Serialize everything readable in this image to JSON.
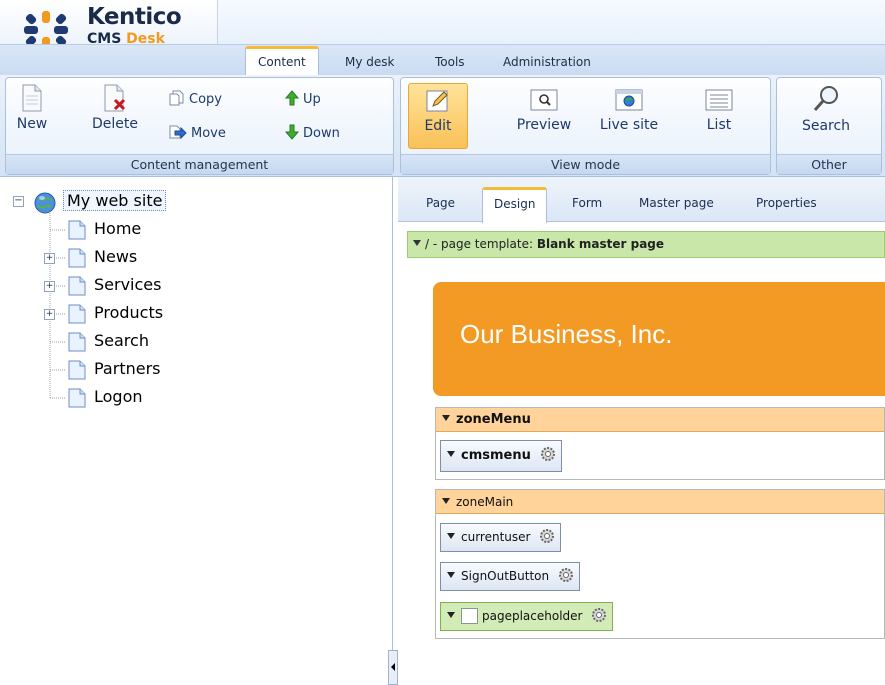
{
  "app": {
    "logo_brand": "Kentico",
    "logo_product_1": "CMS",
    "logo_product_2": "Desk",
    "accent_color": "#f39a1e"
  },
  "main_tabs": [
    {
      "label": "Content",
      "active": true
    },
    {
      "label": "My desk",
      "active": false
    },
    {
      "label": "Tools",
      "active": false
    },
    {
      "label": "Administration",
      "active": false
    }
  ],
  "toolbar": {
    "content_management": {
      "title": "Content management",
      "new_label": "New",
      "delete_label": "Delete",
      "copy_label": "Copy",
      "move_label": "Move",
      "up_label": "Up",
      "down_label": "Down"
    },
    "view_mode": {
      "title": "View mode",
      "edit_label": "Edit",
      "preview_label": "Preview",
      "live_site_label": "Live site",
      "list_label": "List",
      "active": "Edit"
    },
    "other": {
      "title": "Other",
      "search_label": "Search"
    }
  },
  "tree": {
    "root": "My web site",
    "items": [
      {
        "label": "Home",
        "expandable": false
      },
      {
        "label": "News",
        "expandable": true
      },
      {
        "label": "Services",
        "expandable": true
      },
      {
        "label": "Products",
        "expandable": true
      },
      {
        "label": "Search",
        "expandable": false
      },
      {
        "label": "Partners",
        "expandable": false
      },
      {
        "label": "Logon",
        "expandable": false
      }
    ]
  },
  "sub_tabs": [
    {
      "label": "Page",
      "active": false
    },
    {
      "label": "Design",
      "active": true
    },
    {
      "label": "Form",
      "active": false
    },
    {
      "label": "Master page",
      "active": false
    },
    {
      "label": "Properties",
      "active": false
    }
  ],
  "design": {
    "template_prefix": "/ - page template: ",
    "template_name": "Blank master page",
    "banner_text": "Our Business, Inc.",
    "zones": [
      {
        "name": "zoneMenu",
        "webparts": [
          "cmsmenu"
        ]
      },
      {
        "name": "zoneMain",
        "webparts": [
          "currentuser",
          "SignOutButton",
          "pageplaceholder"
        ]
      }
    ]
  }
}
